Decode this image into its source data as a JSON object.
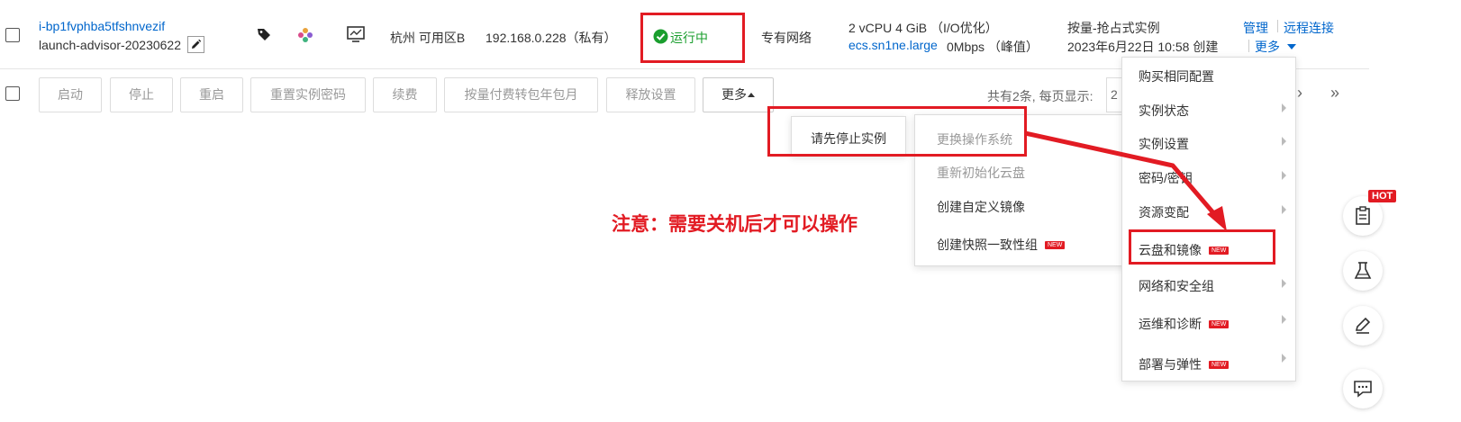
{
  "instance": {
    "id": "i-bp1fvphba5tfshnvezif",
    "name": "launch-advisor-20230622",
    "zone": "杭州 可用区B",
    "ip": "192.168.0.228（私有）",
    "status": "运行中",
    "network": "专有网络",
    "spec": "2 vCPU 4 GiB （I/O优化）",
    "type": "ecs.sn1ne.large",
    "bandwidth": "0Mbps （峰值）",
    "billing": "按量-抢占式实例",
    "created": "2023年6月22日 10:58 创建",
    "actions": {
      "manage": "管理",
      "remote": "远程连接",
      "more": "更多"
    }
  },
  "toolbar": {
    "buttons": [
      "启动",
      "停止",
      "重启",
      "重置实例密码",
      "续费",
      "按量付费转包年包月",
      "释放设置"
    ],
    "more": "更多",
    "pagination_text": "共有2条, 每页显示:",
    "page_size_partial": "2",
    "next": "›",
    "last": "»"
  },
  "tooltip": {
    "text": "请先停止实例"
  },
  "submenu": {
    "items": [
      {
        "label": "更换操作系统",
        "disabled": true,
        "new": false
      },
      {
        "label": "重新初始化云盘",
        "disabled": true,
        "new": false
      },
      {
        "label": "创建自定义镜像",
        "disabled": false,
        "new": false
      },
      {
        "label": "创建快照一致性组",
        "disabled": false,
        "new": true
      }
    ]
  },
  "more_menu": {
    "items": [
      {
        "label": "购买相同配置",
        "arrow": false,
        "new": false
      },
      {
        "label": "实例状态",
        "arrow": true,
        "new": false
      },
      {
        "label": "实例设置",
        "arrow": true,
        "new": false
      },
      {
        "label": "密码/密钥",
        "arrow": true,
        "new": false
      },
      {
        "label": "资源变配",
        "arrow": true,
        "new": false
      },
      {
        "label": "云盘和镜像",
        "arrow": true,
        "new": true
      },
      {
        "label": "网络和安全组",
        "arrow": true,
        "new": false
      },
      {
        "label": "运维和诊断",
        "arrow": true,
        "new": true
      },
      {
        "label": "部署与弹性",
        "arrow": true,
        "new": true
      }
    ],
    "new_tag": "NEW"
  },
  "annotation": {
    "note": "注意：需要关机后才可以操作"
  },
  "float": {
    "hot": "HOT"
  },
  "colors": {
    "accent_red": "#e21b23",
    "link_blue": "#0066cc",
    "status_green": "#1a9e2e"
  },
  "icons": [
    "tag-icon",
    "app-icon",
    "monitor-icon",
    "edit-icon",
    "check-circle-icon",
    "clipboard-icon",
    "flask-icon",
    "pen-icon",
    "chat-icon"
  ]
}
